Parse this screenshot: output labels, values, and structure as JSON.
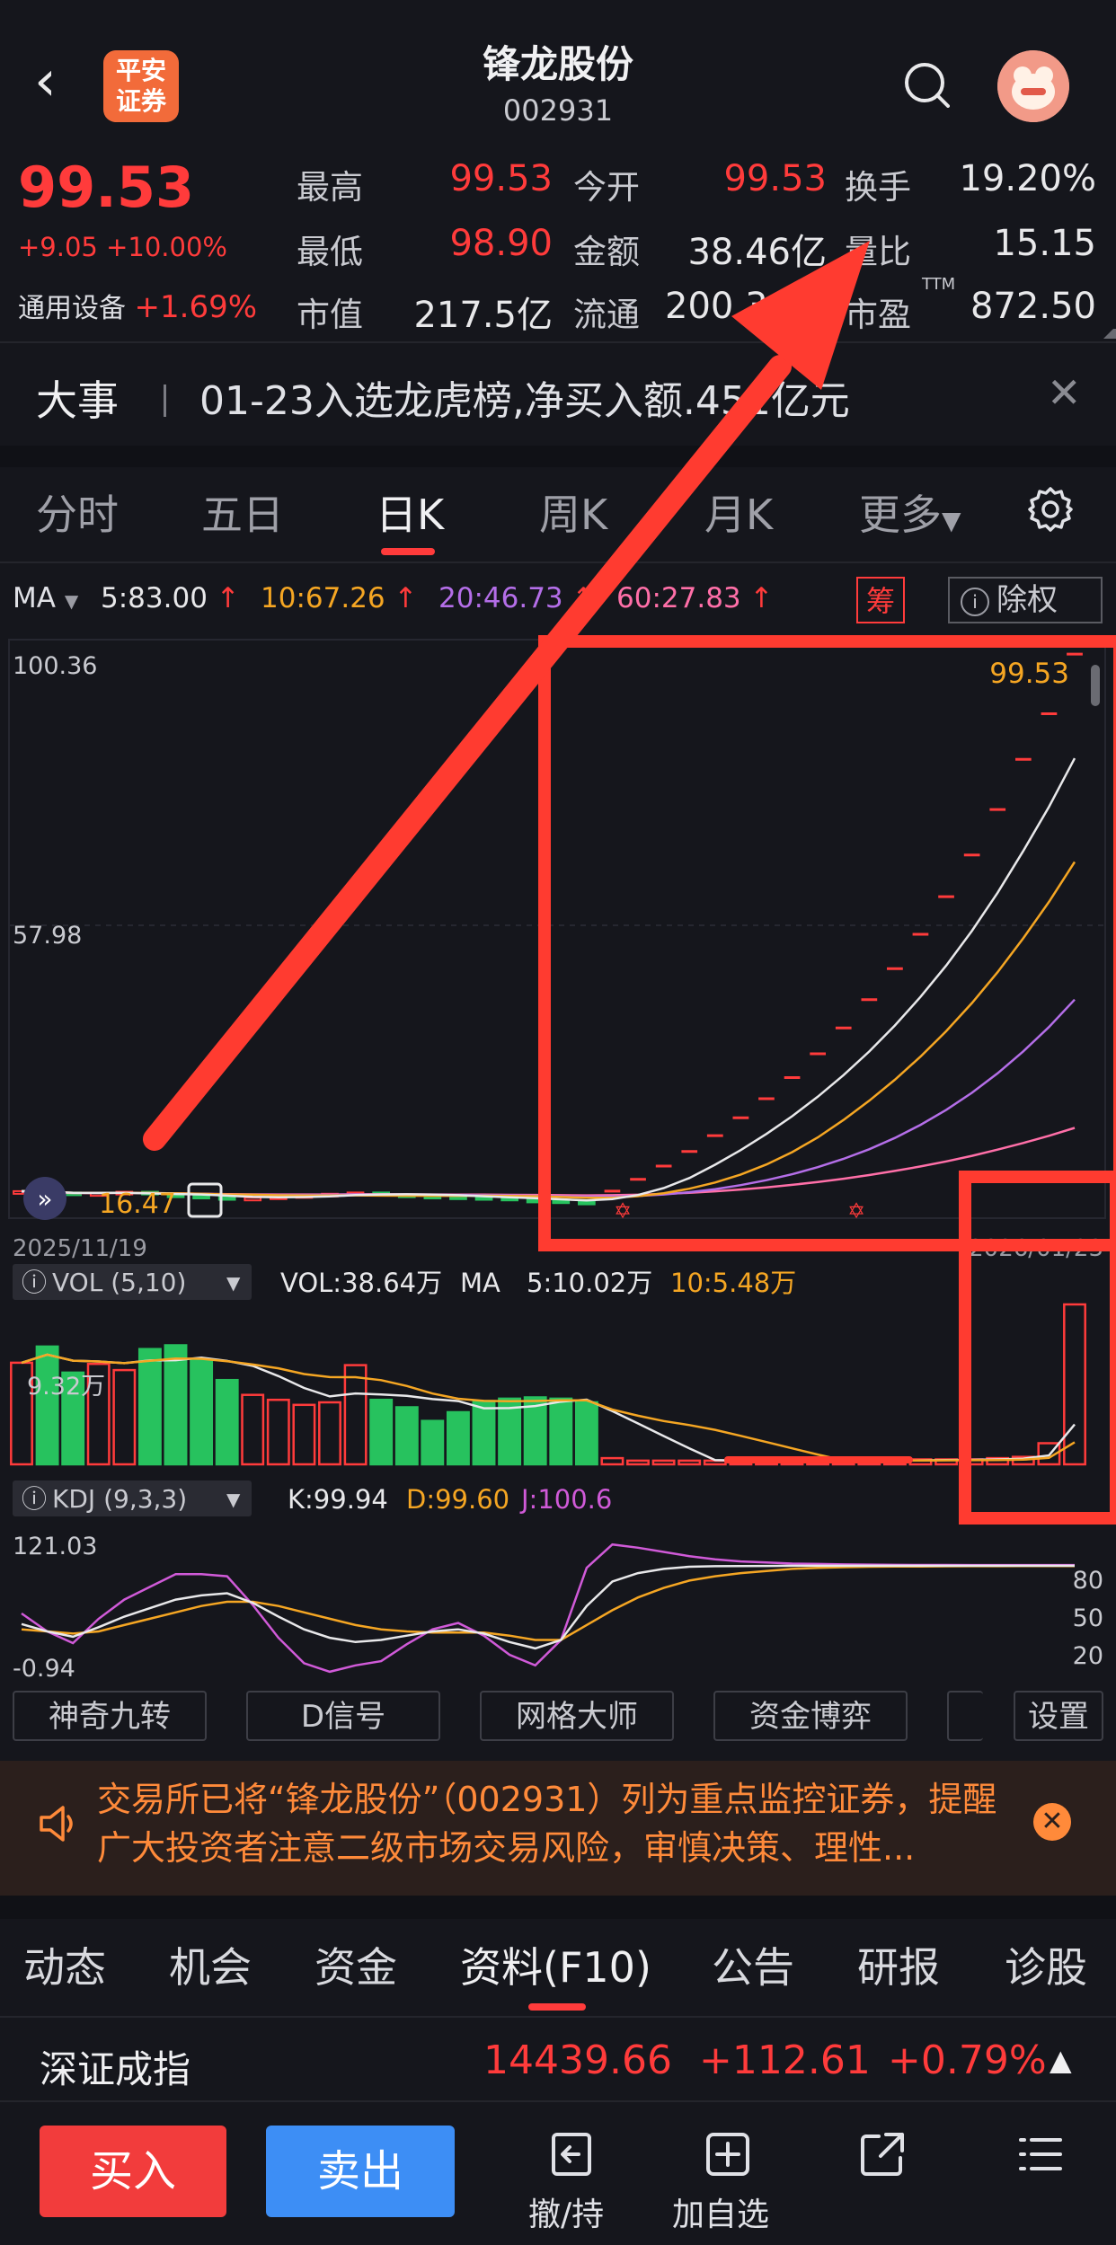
{
  "header": {
    "back_icon": "chevron-left-icon",
    "logo_text": "平安证券",
    "title": "锋龙股份",
    "code": "002931",
    "search_icon": "search-icon",
    "avatar_icon": "assistant-avatar-icon"
  },
  "quote": {
    "price": "99.53",
    "change": "+9.05 +10.00%",
    "sector_name": "通用设备",
    "sector_change": "+1.69%",
    "rows": [
      [
        {
          "label": "最高",
          "value": "99.53",
          "color": "#ff3b3b"
        },
        {
          "label": "今开",
          "value": "99.53",
          "color": "#ff3b3b"
        },
        {
          "label": "换手",
          "value": "19.20%",
          "color": "#e8e8ea"
        }
      ],
      [
        {
          "label": "最低",
          "value": "98.90",
          "color": "#ff3b3b"
        },
        {
          "label": "金额",
          "value": "38.46亿",
          "color": "#e8e8ea"
        },
        {
          "label": "量比",
          "value": "15.15",
          "color": "#e8e8ea"
        }
      ],
      [
        {
          "label": "市值",
          "value": "217.5亿",
          "color": "#e8e8ea"
        },
        {
          "label": "流通",
          "value": "200.3",
          "color": "#e8e8ea"
        },
        {
          "label": "市盈",
          "value": "872.50",
          "color": "#e8e8ea"
        }
      ]
    ],
    "ttm": "TTM"
  },
  "news": {
    "tag": "大事",
    "text": "01-23入选龙虎榜,净买入额",
    "text_tail": ".451亿元",
    "close_icon": "close-icon"
  },
  "period_tabs": [
    "分时",
    "五日",
    "日K",
    "周K",
    "月K",
    "更多"
  ],
  "active_period": "日K",
  "settings_icon": "gear-icon",
  "ma_row": {
    "label": "MA",
    "ma5": "5:83.00",
    "ma10": "10:67.26",
    "ma20": "20:46.73",
    "ma60": "60:27.83",
    "chip_chou": "筹",
    "chip_chuquan": "除权"
  },
  "colors": {
    "up": "#ff3b3b",
    "down": "#27c25e",
    "ma5": "#e8e8ea",
    "ma10": "#f5a623",
    "ma20": "#b46ee8",
    "ma60": "#ff6fa8",
    "annotation": "#ff3b30",
    "notice": "#ff8a3a"
  },
  "chart_data": [
    {
      "type": "candlestick",
      "title": "",
      "y_ticks": [
        "100.36",
        "57.98"
      ],
      "ylim": [
        15.6,
        100.36
      ],
      "last_price_label": "99.53",
      "x_start_label": "2025/11/19",
      "x_end_label": "2026/01/23",
      "low_label": "16.47",
      "closes": [
        18.2,
        18.0,
        17.6,
        17.9,
        18.1,
        17.7,
        17.5,
        17.3,
        17.0,
        17.2,
        17.4,
        17.6,
        17.8,
        18.0,
        17.7,
        17.5,
        17.4,
        17.3,
        17.2,
        16.9,
        16.8,
        16.6,
        16.5,
        18.2,
        20.0,
        22.0,
        24.2,
        26.6,
        29.3,
        32.2,
        35.4,
        39.0,
        42.9,
        47.2,
        51.9,
        57.1,
        62.8,
        69.1,
        76.0,
        83.6,
        90.5,
        99.53
      ],
      "ma5_end": 83.0,
      "ma10_end": 67.26,
      "ma20_end": 46.73,
      "ma60_end": 27.83
    },
    {
      "type": "bar",
      "title": "VOL (5,10)",
      "vol_label": "VOL:38.64万",
      "ma_label": "MA",
      "ma5_label": "5:10.02万",
      "ma10_label": "10:5.48万",
      "y_tick": "9.32万",
      "volumes": [
        8.2,
        9.5,
        7.4,
        8.1,
        7.6,
        9.3,
        9.6,
        8.4,
        6.8,
        5.6,
        5.2,
        4.8,
        5.0,
        8.0,
        5.2,
        4.6,
        3.5,
        4.2,
        5.1,
        5.3,
        5.4,
        5.3,
        5.0,
        0.5,
        0.3,
        0.3,
        0.3,
        0.3,
        0.3,
        0.3,
        0.3,
        0.3,
        0.3,
        0.3,
        0.3,
        0.4,
        0.4,
        0.4,
        0.5,
        0.6,
        1.7,
        12.9
      ]
    },
    {
      "type": "line",
      "title": "KDJ (9,3,3)",
      "k_label": "K:99.94",
      "d_label": "D:99.60",
      "j_label": "J:100.6",
      "y_ticks_left": [
        "121.03",
        "-0.94"
      ],
      "y_ticks_right": [
        "80",
        "50",
        "20"
      ],
      "ylim": [
        -0.94,
        121.03
      ],
      "K": [
        45,
        38,
        33,
        42,
        52,
        60,
        68,
        72,
        74,
        65,
        52,
        40,
        32,
        28,
        30,
        34,
        38,
        40,
        36,
        28,
        22,
        30,
        62,
        85,
        93,
        97,
        99,
        99.5,
        99.7,
        99.8,
        99.9,
        99.9,
        99.9,
        99.94,
        99.94,
        99.94,
        99.94,
        99.94,
        99.94,
        99.94,
        99.94,
        99.94
      ],
      "D": [
        40,
        38,
        36,
        38,
        44,
        50,
        56,
        62,
        66,
        66,
        62,
        56,
        50,
        44,
        40,
        38,
        37,
        37,
        37,
        34,
        30,
        30,
        44,
        58,
        70,
        79,
        86,
        90,
        93,
        95,
        97,
        98,
        98.6,
        99.0,
        99.2,
        99.3,
        99.4,
        99.5,
        99.55,
        99.58,
        99.6,
        99.6
      ],
      "J": [
        55,
        38,
        27,
        50,
        68,
        80,
        92,
        92,
        90,
        63,
        32,
        8,
        0,
        6,
        10,
        26,
        40,
        46,
        34,
        16,
        6,
        30,
        98,
        120,
        117,
        113,
        109,
        106,
        104,
        103,
        102,
        101.6,
        101.2,
        101.0,
        100.8,
        100.7,
        100.7,
        100.6,
        100.6,
        100.6,
        100.6,
        100.6
      ]
    }
  ],
  "indicator_buttons": [
    "神奇九转",
    "D信号",
    "网格大师",
    "资金博弈",
    "",
    "设置"
  ],
  "notice": {
    "speaker_icon": "speaker-icon",
    "text": "交易所已将“锋龙股份”（002931）列为重点监控证券，提醒广大投资者注意二级市场交易风险，审慎决策、理性...",
    "close_icon": "close-circle-icon"
  },
  "bottom_tabs": [
    "动态",
    "机会",
    "资金",
    "资料(F10)",
    "公告",
    "研报",
    "诊股"
  ],
  "active_bottom_tab": "资料(F10)",
  "index": {
    "name": "深证成指",
    "value": "14439.66",
    "change": "+112.61",
    "pct": "+0.79%",
    "toggle_icon": "triangle-up-icon"
  },
  "actions": {
    "buy": "买入",
    "sell": "卖出",
    "items": [
      {
        "label": "撤/持",
        "icon": "undo-order-icon"
      },
      {
        "label": "加自选",
        "icon": "add-watchlist-icon"
      },
      {
        "label": "",
        "icon": "share-icon"
      },
      {
        "label": "",
        "icon": "menu-icon"
      }
    ]
  }
}
